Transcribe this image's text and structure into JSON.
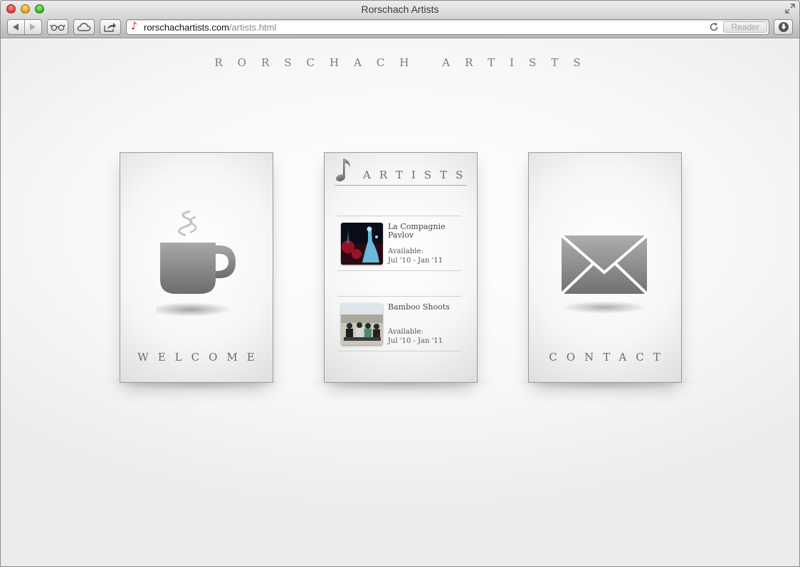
{
  "window": {
    "title": "Rorschach Artists"
  },
  "toolbar": {
    "url_host": "rorschachartists.com",
    "url_path": "/artists.html",
    "reader_label": "Reader"
  },
  "page": {
    "site_title": "RORSCHACH ARTISTS",
    "cards": {
      "welcome": {
        "label": "WELCOME"
      },
      "artists": {
        "heading": "ARTISTS"
      },
      "contact": {
        "label": "CONTACT"
      }
    },
    "artists": [
      {
        "name": "La Compagnie Pavlov",
        "available_label": "Available:",
        "available_dates": "Jul '10 - Jan '11"
      },
      {
        "name": "Bamboo Shoots",
        "available_label": "Available:",
        "available_dates": "Jul '10 - Jan '11"
      }
    ]
  }
}
